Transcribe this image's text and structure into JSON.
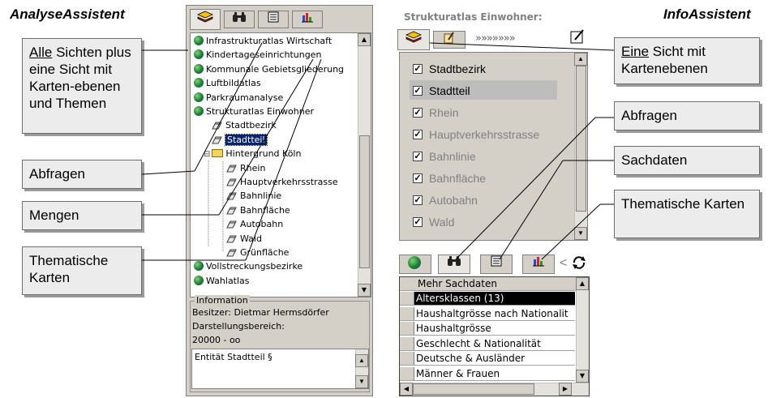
{
  "left_heading": "AnalyseAssistent",
  "right_heading": "InfoAssistent",
  "left_callouts": {
    "views_underline": "Alle",
    "views_rest": " Sichten plus eine Sicht mit Karten-ebenen und Themen",
    "queries": "Abfragen",
    "sets": "Mengen",
    "thematic": "Thematische Karten"
  },
  "right_callouts": {
    "view_underline": "Eine",
    "view_rest": " Sicht mit Kartenebenen",
    "queries": "Abfragen",
    "facts": "Sachdaten",
    "thematic": "Thematische Karten"
  },
  "tree": {
    "items": [
      {
        "label": "Infrastrukturatlas Wirtschaft",
        "icon": "globe-icon"
      },
      {
        "label": "Kindertageseinrichtungen",
        "icon": "globe-icon"
      },
      {
        "label": "Kommunale Gebietsgliederung",
        "icon": "globe-icon"
      },
      {
        "label": "Luftbildatlas",
        "icon": "globe-icon"
      },
      {
        "label": "Parkraumanalyse",
        "icon": "globe-icon"
      },
      {
        "label": "Strukturatlas Einwohner",
        "icon": "globe-icon"
      },
      {
        "label": "Stadtbezirk",
        "icon": "layer-icon"
      },
      {
        "label": "Stadtteil",
        "icon": "layer-icon",
        "selected": true
      },
      {
        "label": "Hintergrund Köln",
        "icon": "folder-icon"
      },
      {
        "label": "Rhein",
        "icon": "layer-icon"
      },
      {
        "label": "Hauptverkehrsstrasse",
        "icon": "layer-icon"
      },
      {
        "label": "Bahnlinie",
        "icon": "layer-icon"
      },
      {
        "label": "Bahnfläche",
        "icon": "layer-icon"
      },
      {
        "label": "Autobahn",
        "icon": "layer-icon"
      },
      {
        "label": "Wald",
        "icon": "layer-icon"
      },
      {
        "label": "Grünfläche",
        "icon": "layer-icon"
      },
      {
        "label": "Vollstreckungsbezirke",
        "icon": "globe-icon"
      },
      {
        "label": "Wahlatlas",
        "icon": "globe-icon"
      }
    ]
  },
  "info": {
    "group_label": "Information",
    "owner": "Besitzer: Dietmar Hermsdörfer",
    "range_label": "Darstellungsbereich:",
    "range_value": "20000 - oo",
    "entity": "Entität Stadtteil §"
  },
  "right_panel": {
    "title": "Strukturatlas Einwohner:",
    "arrows": "»»»»»»»",
    "layers": [
      {
        "label": "Stadtbezirk",
        "checked": true
      },
      {
        "label": "Stadtteil",
        "checked": true,
        "selected": true
      },
      {
        "label": "Rhein",
        "checked": true,
        "dim": true
      },
      {
        "label": "Hauptverkehrsstrasse",
        "checked": true,
        "dim": true
      },
      {
        "label": "Bahnlinie",
        "checked": true,
        "dim": true
      },
      {
        "label": "Bahnfläche",
        "checked": true,
        "dim": true
      },
      {
        "label": "Autobahn",
        "checked": true,
        "dim": true
      },
      {
        "label": "Wald",
        "checked": true,
        "dim": true
      }
    ],
    "grid_header": "Mehr Sachdaten",
    "grid_rows": [
      {
        "label": "Altersklassen (13)",
        "selected": true
      },
      {
        "label": "Haushaltgrösse nach Nationalit"
      },
      {
        "label": "Haushaltgrösse"
      },
      {
        "label": "Geschlecht & Nationalität"
      },
      {
        "label": "Deutsche & Ausländer"
      },
      {
        "label": "Männer & Frauen"
      }
    ]
  }
}
